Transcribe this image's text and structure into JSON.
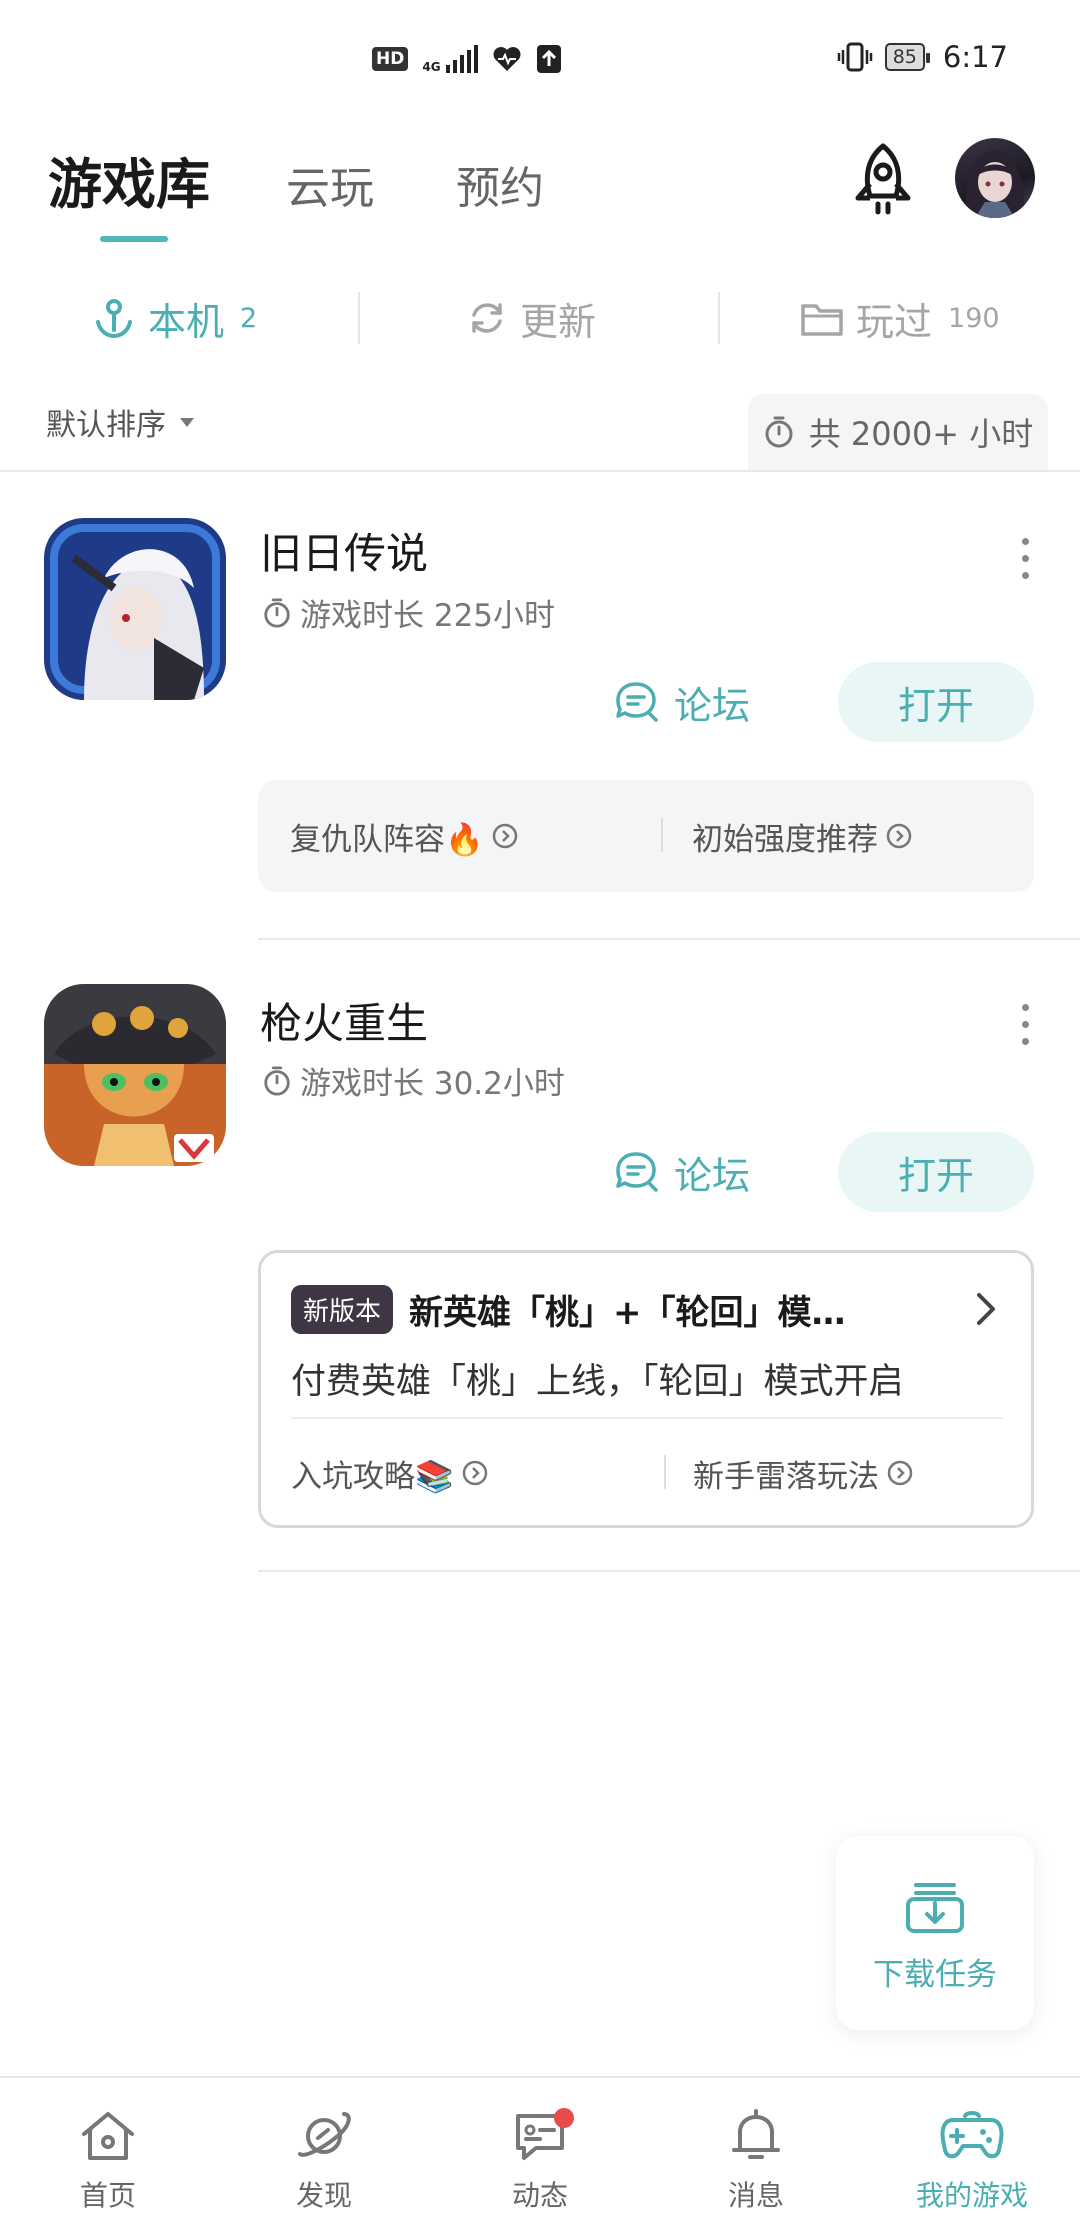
{
  "status_bar": {
    "hd": "HD",
    "network": "4G",
    "battery": "85",
    "time": "6:17"
  },
  "top_tabs": [
    {
      "label": "游戏库",
      "active": true
    },
    {
      "label": "云玩",
      "active": false
    },
    {
      "label": "预约",
      "active": false
    }
  ],
  "sub_tabs": [
    {
      "label": "本机",
      "count": "2",
      "icon": "anchor-icon",
      "active": true
    },
    {
      "label": "更新",
      "count": "",
      "icon": "refresh-icon",
      "active": false
    },
    {
      "label": "玩过",
      "count": "190",
      "icon": "folder-icon",
      "active": false
    }
  ],
  "sort": {
    "label": "默认排序",
    "total_time": "共 2000+ 小时"
  },
  "games": [
    {
      "title": "旧日传说",
      "playtime": "游戏时长 225小时",
      "forum_label": "论坛",
      "open_label": "打开",
      "tips": [
        "复仇队阵容🔥",
        "初始强度推荐"
      ]
    },
    {
      "title": "枪火重生",
      "playtime": "游戏时长 30.2小时",
      "forum_label": "论坛",
      "open_label": "打开",
      "news": {
        "badge": "新版本",
        "title": "新英雄「桃」+「轮回」模…",
        "description": "付费英雄「桃」上线，「轮回」模式开启"
      },
      "tips": [
        "入坑攻略📚",
        "新手雷落玩法"
      ]
    }
  ],
  "download": {
    "label": "下载任务"
  },
  "bottom_nav": [
    {
      "label": "首页",
      "icon": "home-icon",
      "active": false
    },
    {
      "label": "发现",
      "icon": "planet-icon",
      "active": false
    },
    {
      "label": "动态",
      "icon": "chat-icon",
      "active": false,
      "badge": true
    },
    {
      "label": "消息",
      "icon": "bell-icon",
      "active": false
    },
    {
      "label": "我的游戏",
      "icon": "gamepad-icon",
      "active": true
    }
  ],
  "colors": {
    "accent": "#4aaeb2",
    "badge_red": "#e94a4a"
  }
}
